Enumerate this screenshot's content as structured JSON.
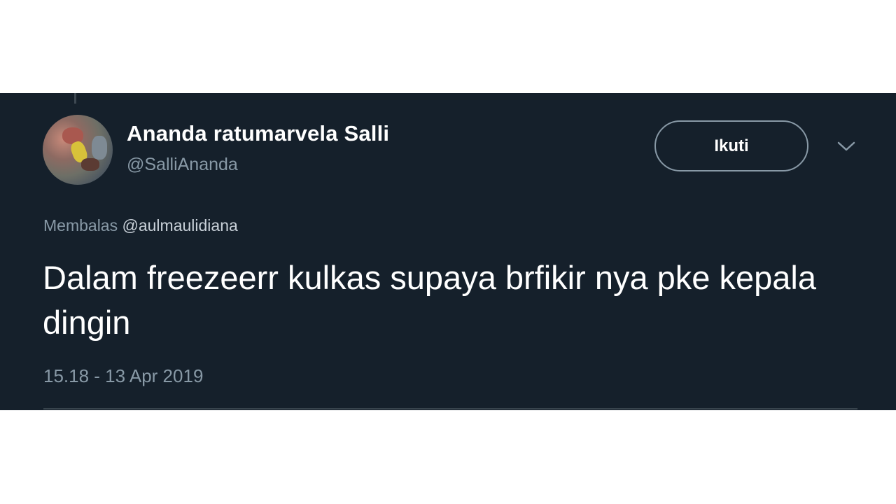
{
  "tweet": {
    "display_name": "Ananda ratumarvela Salli",
    "handle": "@SalliAnanda",
    "follow_label": "Ikuti",
    "reply_prefix": "Membalas",
    "reply_to": "@aulmaulidiana",
    "text": "Dalam freezeerr kulkas supaya brfikir nya pke kepala dingin",
    "timestamp": "15.18 - 13 Apr 2019",
    "more_icon": "chevron-down-icon",
    "avatar_icon": "avatar"
  },
  "colors": {
    "background": "#15202b",
    "page": "#ffffff",
    "text_primary": "#ffffff",
    "text_secondary": "#8899a6",
    "border": "#38444d"
  }
}
